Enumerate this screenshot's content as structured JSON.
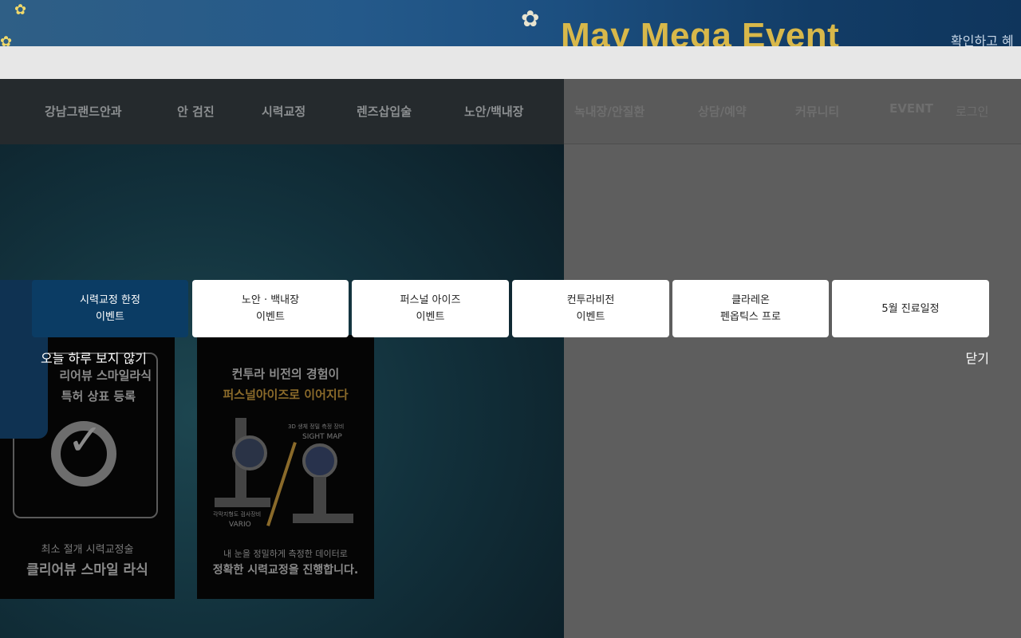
{
  "banner": {
    "title": "May Mega Event",
    "cta": "확인하고 혜"
  },
  "nav": {
    "items": [
      "강남그랜드안과",
      "안 검진",
      "시력교정",
      "렌즈삽입술",
      "노안/백내장",
      "녹내장/안질환",
      "상담/예약",
      "커뮤니티",
      "EVENT"
    ],
    "login": "로그인"
  },
  "background_cards": {
    "card1": {
      "top_line1": "리어뷰 스마일라식",
      "top_line2": "특허 상표 등록",
      "bottom_line1": "최소 절개 시력교정술",
      "bottom_line2": "클리어뷰 스마일 라식"
    },
    "card2": {
      "headline1": "컨투라 비전의 경험이",
      "headline2": "퍼스널아이즈로 이어지다",
      "label_a": "3D 생체 정밀 측정 장비",
      "label_b": "SIGHT MAP",
      "label_c": "각막지형도 검사장비",
      "label_d": "VARIO",
      "footer1": "내 눈을 정밀하게 측정한 데이터로",
      "footer2": "정확한 시력교정을 진행합니다."
    }
  },
  "popup": {
    "tabs": [
      {
        "line1": "시력교정 한정",
        "line2": "이벤트",
        "active": true
      },
      {
        "line1": "노안 · 백내장",
        "line2": "이벤트",
        "active": false
      },
      {
        "line1": "퍼스널 아이즈",
        "line2": "이벤트",
        "active": false
      },
      {
        "line1": "컨투라비전",
        "line2": "이벤트",
        "active": false
      },
      {
        "line1": "클라레온",
        "line2": "펜옵틱스 프로",
        "active": false
      },
      {
        "line1": "5월 진료일정",
        "line2": "",
        "active": false
      }
    ],
    "no_show_today": "오늘 하루 보지 않기",
    "close": "닫기"
  },
  "colors": {
    "active_tab": "#0b3c64",
    "tab_bg": "#ffffff",
    "banner_title": "#d8b84a"
  }
}
